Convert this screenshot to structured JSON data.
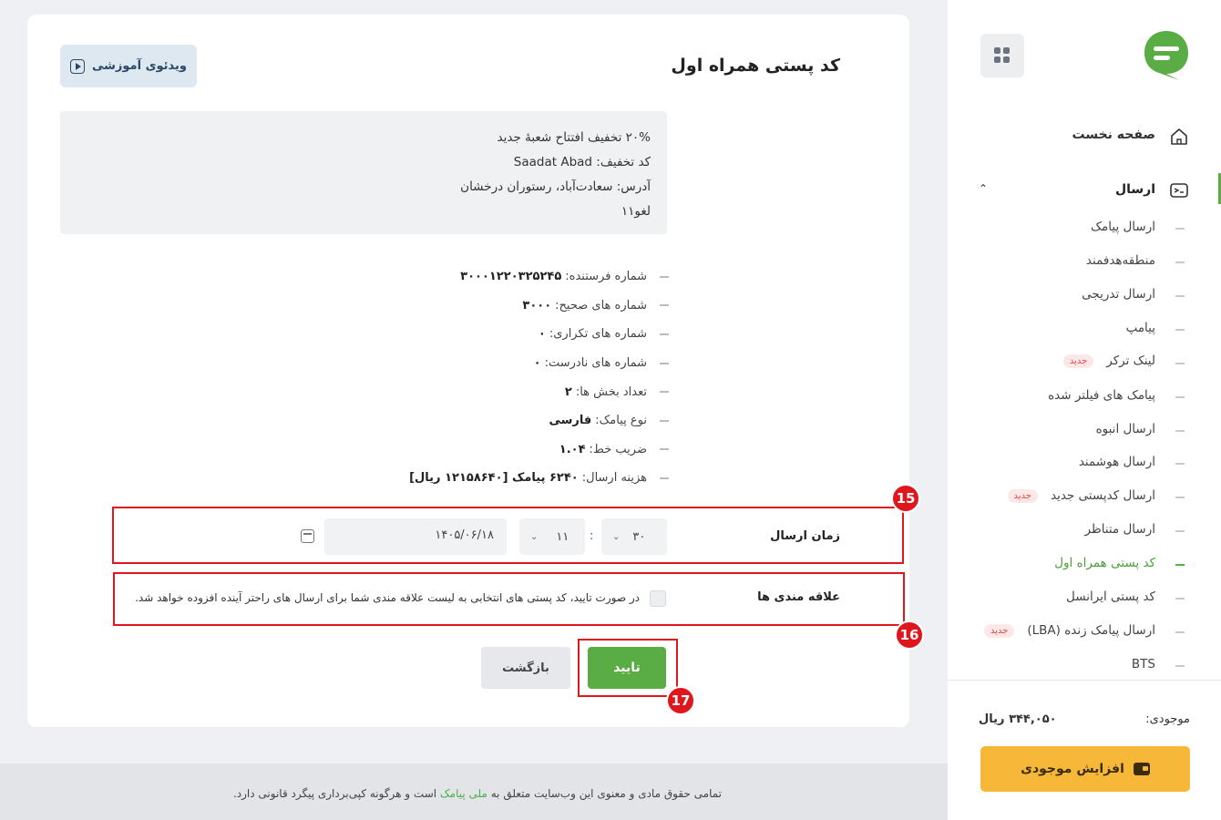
{
  "page": {
    "title": "کد پستی همراه اول",
    "video_button": "ویدئوی آموزشی"
  },
  "message": {
    "lines": [
      "۲۰% تخفیف افتتاح شعبهٔ جدید",
      "کد تخفیف: Saadat Abad",
      "آدرس: سعادت‌آباد، رستوران درخشان",
      "لغو۱۱"
    ]
  },
  "details": [
    {
      "label": "شماره فرستنده:",
      "value": "۳۰۰۰۱۲۲۰۳۲۵۲۴۵"
    },
    {
      "label": "شماره های صحیح:",
      "value": "۳۰۰۰"
    },
    {
      "label": "شماره های تکراری:",
      "value": "۰"
    },
    {
      "label": "شماره های نادرست:",
      "value": "۰"
    },
    {
      "label": "تعداد بخش ها:",
      "value": "۲"
    },
    {
      "label": "نوع پیامک:",
      "value": "فارسی"
    },
    {
      "label": "ضریب خط:",
      "value": "۱.۰۴"
    },
    {
      "label": "هزینه ارسال:",
      "value": "۶۲۴۰ پیامک [۱۲۱۵۸۶۴۰ ریال]"
    }
  ],
  "schedule": {
    "label": "زمان ارسال",
    "minute": "۳۰",
    "hour": "۱۱",
    "colon": ":",
    "date": "۱۴۰۵/۰۶/۱۸"
  },
  "favorites": {
    "label": "علاقه مندی ها",
    "checked": false,
    "text": "در صورت تایید، کد پستی های انتخابی به لیست علاقه مندی شما برای ارسال های راحتر آینده افزوده خواهد شد."
  },
  "actions": {
    "confirm": "تایید",
    "back": "بازگشت"
  },
  "annotations": [
    "15",
    "16",
    "17"
  ],
  "footer": {
    "text_before": "تمامی حقوق مادی و معنوی این وب‌سایت متعلق به",
    "brand": "ملی پیامک",
    "text_after": "است و هرگونه کپی‌برداری پیگرد قانونی دارد."
  },
  "sidebar": {
    "home": "صفحه نخست",
    "send": "ارسال",
    "items": [
      {
        "label": "ارسال پیامک",
        "new": false
      },
      {
        "label": "منطقه‌هدفمند",
        "new": false
      },
      {
        "label": "ارسال تدریجی",
        "new": false
      },
      {
        "label": "پیامپ",
        "new": false
      },
      {
        "label": "لینک ترکر",
        "new": true
      },
      {
        "label": "پیامک های فیلتر شده",
        "new": false
      },
      {
        "label": "ارسال انبوه",
        "new": false
      },
      {
        "label": "ارسال هوشمند",
        "new": false
      },
      {
        "label": "ارسال کدپستی جدید",
        "new": true
      },
      {
        "label": "ارسال متناظر",
        "new": false
      },
      {
        "label": "کد پستی همراه اول",
        "new": false,
        "active": true
      },
      {
        "label": "کد پستی ایرانسل",
        "new": false
      },
      {
        "label": "ارسال پیامک زنده (LBA)",
        "new": true
      },
      {
        "label": "BTS",
        "new": false
      }
    ],
    "new_tag": "جدید",
    "balance_label": "موجودی:",
    "balance_value": "۳۴۴,۰۵۰ ریال",
    "charge_button": "افزایش موجودی"
  },
  "colors": {
    "accent_green": "#5aad45",
    "annotation_red": "#e0161d",
    "charge_yellow": "#f7b83a"
  }
}
